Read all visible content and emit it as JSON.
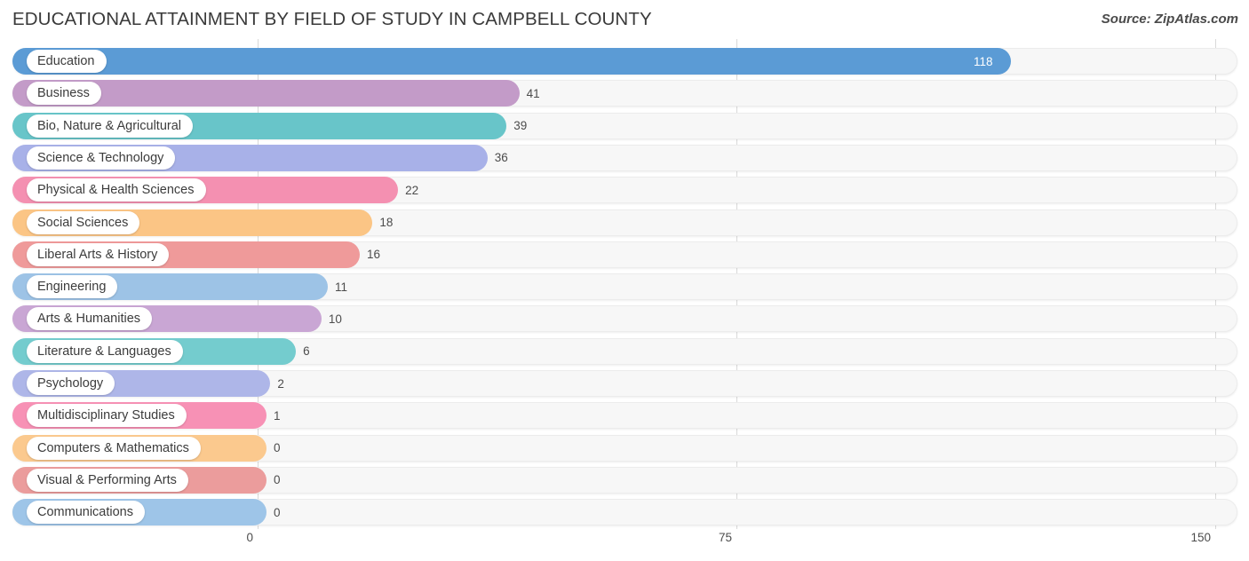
{
  "header": {
    "title": "EDUCATIONAL ATTAINMENT BY FIELD OF STUDY IN CAMPBELL COUNTY",
    "source": "Source: ZipAtlas.com"
  },
  "chart_data": {
    "type": "bar",
    "orientation": "horizontal",
    "title": "EDUCATIONAL ATTAINMENT BY FIELD OF STUDY IN CAMPBELL COUNTY",
    "xlabel": "",
    "ylabel": "",
    "xlim": [
      0,
      150
    ],
    "xticks": [
      0,
      75,
      150
    ],
    "xtick_labels": [
      "0",
      "75",
      "150"
    ],
    "grid": true,
    "legend": false,
    "categories": [
      "Education",
      "Business",
      "Bio, Nature & Agricultural",
      "Science & Technology",
      "Physical & Health Sciences",
      "Social Sciences",
      "Liberal Arts & History",
      "Engineering",
      "Arts & Humanities",
      "Literature & Languages",
      "Psychology",
      "Multidisciplinary Studies",
      "Computers & Mathematics",
      "Visual & Performing Arts",
      "Communications"
    ],
    "values": [
      118,
      41,
      39,
      36,
      22,
      18,
      16,
      11,
      10,
      6,
      2,
      1,
      0,
      0,
      0
    ],
    "value_labels": [
      "118",
      "41",
      "39",
      "36",
      "22",
      "18",
      "16",
      "11",
      "10",
      "6",
      "2",
      "1",
      "0",
      "0",
      "0"
    ],
    "colors": [
      "#5b9bd5",
      "#c39bc8",
      "#68c5c9",
      "#a8b1e8",
      "#f490b1",
      "#fbc585",
      "#ef9a9a",
      "#9dc3e6",
      "#c9a6d4",
      "#74ccce",
      "#aeb6e8",
      "#f791b5",
      "#fbc98e",
      "#eb9c9c",
      "#9ec5e8"
    ]
  }
}
